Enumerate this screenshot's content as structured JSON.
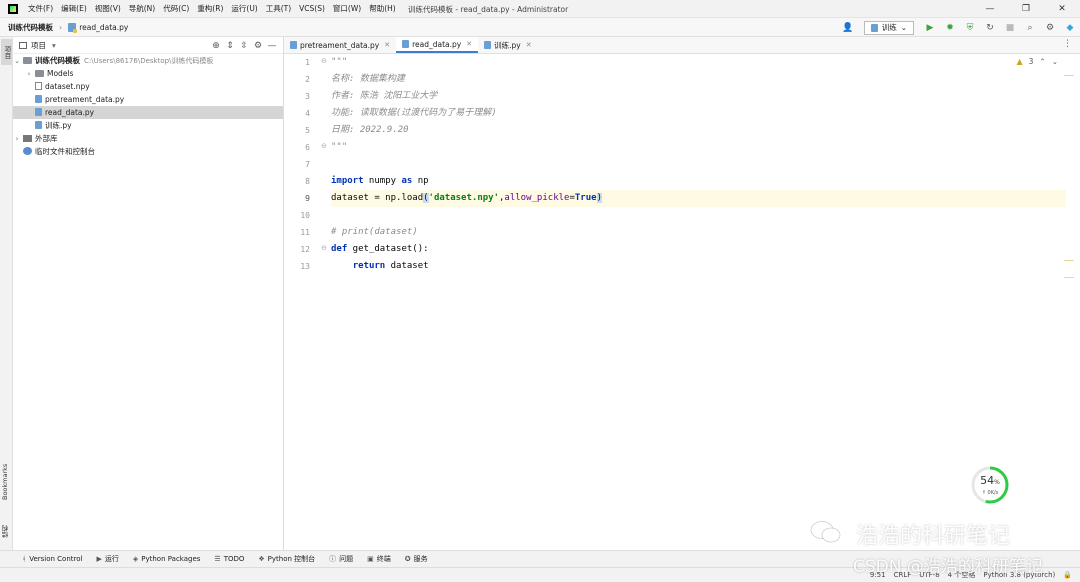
{
  "menu": {
    "items": [
      "文件(F)",
      "编辑(E)",
      "视图(V)",
      "导航(N)",
      "代码(C)",
      "重构(R)",
      "运行(U)",
      "工具(T)",
      "VCS(S)",
      "窗口(W)",
      "帮助(H)"
    ],
    "window_title": "训练代码模板 - read_data.py - Administrator"
  },
  "navbar": {
    "project": "训练代码模板",
    "file": "read_data.py",
    "run_config": "训练"
  },
  "left_strip": {
    "project_tab": "项目",
    "bookmarks_tab": "Bookmarks",
    "structure_tab": "结构"
  },
  "project_panel": {
    "title": "项目",
    "tree": {
      "root": "训练代码模板",
      "root_path": "C:\\Users\\86176\\Desktop\\训练代码模板",
      "models": "Models",
      "dataset": "dataset.npy",
      "pretreament": "pretreament_data.py",
      "read_data": "read_data.py",
      "train": "训练.py",
      "external": "外部库",
      "scratches": "临时文件和控制台"
    }
  },
  "editor": {
    "tabs": [
      "pretreament_data.py",
      "read_data.py",
      "训练.py"
    ],
    "active_tab": 1,
    "inspections": "3",
    "line_numbers": [
      "1",
      "2",
      "3",
      "4",
      "5",
      "6",
      "7",
      "8",
      "9",
      "10",
      "11",
      "12",
      "13"
    ],
    "current_line": 9,
    "code": {
      "l1": "\"\"\"",
      "l2": "名称: 数据集构建",
      "l3": "作者: 陈浩 沈阳工业大学",
      "l4": "功能: 读取数据(过渡代码为了易于理解)",
      "l5": "日期: 2022.9.20",
      "l6": "\"\"\"",
      "l8_kw1": "import",
      "l8_mod": " numpy ",
      "l8_kw2": "as",
      "l8_alias": " np",
      "l9_a": "dataset = np.load",
      "l9_p1": "(",
      "l9_str": "'dataset.npy'",
      "l9_comma": ",",
      "l9_param": "allow_pickle",
      "l9_eq": "=",
      "l9_true": "True",
      "l9_p2": ")",
      "l11": "# print(dataset)",
      "l12_kw": "def",
      "l12_rest": " get_dataset():",
      "l13_indent": "    ",
      "l13_kw": "return",
      "l13_rest": " dataset"
    }
  },
  "bottom_tools": [
    "Version Control",
    "运行",
    "Python Packages",
    "TODO",
    "Python 控制台",
    "问题",
    "终端",
    "服务"
  ],
  "status": {
    "position": "9:51",
    "line_sep": "CRLF",
    "encoding": "UTF-8",
    "indent": "4 个空格",
    "interpreter": "Python 3.8 (pytorch)"
  },
  "gauge": {
    "percent": 54,
    "percent_text": "54",
    "unit": "%",
    "rate": "0K/s"
  },
  "watermark": {
    "line1": "浩浩的科研笔记",
    "line2": "CSDN @浩浩的科研笔记"
  },
  "colors": {
    "keyword": "#0033b3",
    "string": "#067d17",
    "comment": "#8c8c8c",
    "current_line": "#fffae3",
    "run_green": "#3ea33e",
    "gauge_green": "#2ecc40"
  }
}
